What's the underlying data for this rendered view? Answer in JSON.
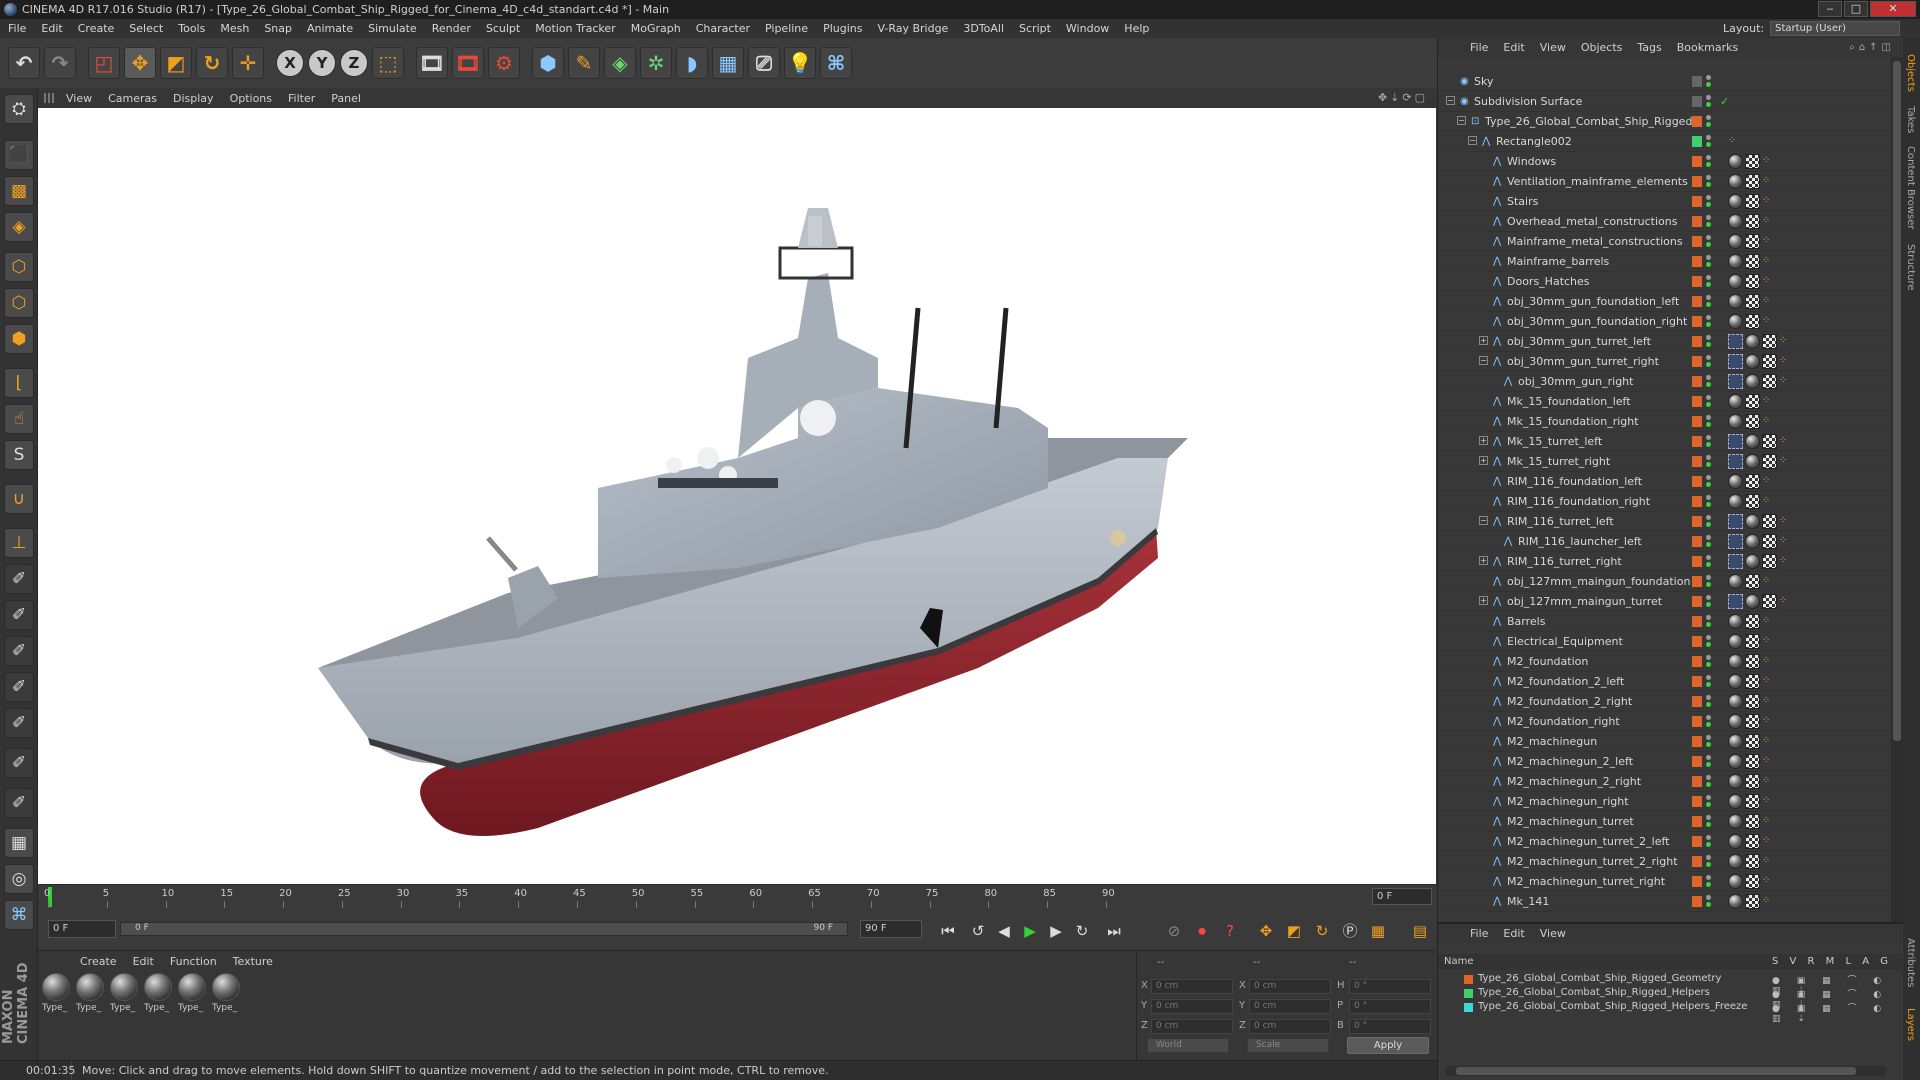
{
  "window": {
    "title": "CINEMA 4D R17.016 Studio (R17) - [Type_26_Global_Combat_Ship_Rigged_for_Cinema_4D_c4d_standart.c4d *] - Main",
    "minimize": "‒",
    "maximize": "□",
    "close": "✕"
  },
  "menu": [
    "File",
    "Edit",
    "Create",
    "Select",
    "Tools",
    "Mesh",
    "Snap",
    "Animate",
    "Simulate",
    "Render",
    "Sculpt",
    "Motion Tracker",
    "MoGraph",
    "Character",
    "Pipeline",
    "Plugins",
    "V-Ray Bridge",
    "3DToAll",
    "Script",
    "Window",
    "Help"
  ],
  "layout": {
    "label": "Layout:",
    "value": "Startup (User)"
  },
  "toolbar": {
    "icons": [
      "undo-icon",
      "redo-icon",
      "live-selection-icon",
      "move-icon",
      "scale-icon",
      "rotate-icon",
      "last-tool-icon",
      "x-axis-icon",
      "y-axis-icon",
      "z-axis-icon",
      "coordinate-system-icon",
      "render-view-icon",
      "render-picture-viewer-icon",
      "render-settings-icon",
      "cube-icon",
      "pen-icon",
      "subdivision-icon",
      "array-icon",
      "deformer-icon",
      "floor-icon",
      "camera-icon",
      "light-icon",
      "python-icon"
    ],
    "axis_labels": [
      "X",
      "Y",
      "Z"
    ]
  },
  "viewport": {
    "menu": [
      "View",
      "Cameras",
      "Display",
      "Options",
      "Filter",
      "Panel"
    ]
  },
  "timeline": {
    "ticks": [
      "0",
      "5",
      "10",
      "15",
      "20",
      "25",
      "30",
      "35",
      "40",
      "45",
      "50",
      "55",
      "60",
      "65",
      "70",
      "75",
      "80",
      "85",
      "90"
    ],
    "current_frame": "0 F"
  },
  "transport": {
    "start_field": "0 F",
    "slider_start": "0 F",
    "slider_end": "90 F",
    "end_field": "90 F"
  },
  "materials": {
    "menu": [
      "Create",
      "Edit",
      "Function",
      "Texture"
    ],
    "items": [
      "Type_",
      "Type_",
      "Type_",
      "Type_",
      "Type_",
      "Type_"
    ]
  },
  "coordinates": {
    "header1": "--",
    "header2": "--",
    "header3": "--",
    "rows": [
      {
        "a": "X",
        "av": "0 cm",
        "b": "X",
        "bv": "0 cm",
        "c": "H",
        "cv": "0 °"
      },
      {
        "a": "Y",
        "av": "0 cm",
        "b": "Y",
        "bv": "0 cm",
        "c": "P",
        "cv": "0 °"
      },
      {
        "a": "Z",
        "av": "0 cm",
        "b": "Z",
        "bv": "0 cm",
        "c": "B",
        "cv": "0 °"
      }
    ],
    "mode1": "World",
    "mode2": "Scale",
    "apply": "Apply"
  },
  "status": {
    "time": "00:01:35",
    "message": "Move: Click and drag to move elements. Hold down SHIFT to quantize movement / add to the selection in point mode, CTRL to remove."
  },
  "object_manager": {
    "menu": [
      "File",
      "Edit",
      "View",
      "Objects",
      "Tags",
      "Bookmarks"
    ],
    "rows": [
      {
        "name": "Sky",
        "depth": 0,
        "exp": "",
        "tags": 0
      },
      {
        "name": "Subdivision Surface",
        "depth": 0,
        "exp": "−",
        "tags": 0
      },
      {
        "name": "Type_26_Global_Combat_Ship_Rigged",
        "depth": 1,
        "exp": "−",
        "tags": 0
      },
      {
        "name": "Rectangle002",
        "depth": 2,
        "exp": "−",
        "tags": 1
      },
      {
        "name": "Windows",
        "depth": 3,
        "exp": "",
        "tags": 3
      },
      {
        "name": "Ventilation_mainframe_elements",
        "depth": 3,
        "exp": "",
        "tags": 3
      },
      {
        "name": "Stairs",
        "depth": 3,
        "exp": "",
        "tags": 3
      },
      {
        "name": "Overhead_metal_constructions",
        "depth": 3,
        "exp": "",
        "tags": 3
      },
      {
        "name": "Mainframe_metal_constructions",
        "depth": 3,
        "exp": "",
        "tags": 3
      },
      {
        "name": "Mainframe_barrels",
        "depth": 3,
        "exp": "",
        "tags": 3
      },
      {
        "name": "Doors_Hatches",
        "depth": 3,
        "exp": "",
        "tags": 3
      },
      {
        "name": "obj_30mm_gun_foundation_left",
        "depth": 3,
        "exp": "",
        "tags": 3
      },
      {
        "name": "obj_30mm_gun_foundation_right",
        "depth": 3,
        "exp": "",
        "tags": 3
      },
      {
        "name": "obj_30mm_gun_turret_left",
        "depth": 3,
        "exp": "+",
        "tags": 4
      },
      {
        "name": "obj_30mm_gun_turret_right",
        "depth": 3,
        "exp": "−",
        "tags": 4
      },
      {
        "name": "obj_30mm_gun_right",
        "depth": 4,
        "exp": "",
        "tags": 4
      },
      {
        "name": "Mk_15_foundation_left",
        "depth": 3,
        "exp": "",
        "tags": 3
      },
      {
        "name": "Mk_15_foundation_right",
        "depth": 3,
        "exp": "",
        "tags": 3
      },
      {
        "name": "Mk_15_turret_left",
        "depth": 3,
        "exp": "+",
        "tags": 4
      },
      {
        "name": "Mk_15_turret_right",
        "depth": 3,
        "exp": "+",
        "tags": 4
      },
      {
        "name": "RIM_116_foundation_left",
        "depth": 3,
        "exp": "",
        "tags": 3
      },
      {
        "name": "RIM_116_foundation_right",
        "depth": 3,
        "exp": "",
        "tags": 3
      },
      {
        "name": "RIM_116_turret_left",
        "depth": 3,
        "exp": "−",
        "tags": 4
      },
      {
        "name": "RIM_116_launcher_left",
        "depth": 4,
        "exp": "",
        "tags": 4
      },
      {
        "name": "RIM_116_turret_right",
        "depth": 3,
        "exp": "+",
        "tags": 4
      },
      {
        "name": "obj_127mm_maingun_foundation",
        "depth": 3,
        "exp": "",
        "tags": 3
      },
      {
        "name": "obj_127mm_maingun_turret",
        "depth": 3,
        "exp": "+",
        "tags": 4
      },
      {
        "name": "Barrels",
        "depth": 3,
        "exp": "",
        "tags": 3
      },
      {
        "name": "Electrical_Equipment",
        "depth": 3,
        "exp": "",
        "tags": 3
      },
      {
        "name": "M2_foundation",
        "depth": 3,
        "exp": "",
        "tags": 3
      },
      {
        "name": "M2_foundation_2_left",
        "depth": 3,
        "exp": "",
        "tags": 3
      },
      {
        "name": "M2_foundation_2_right",
        "depth": 3,
        "exp": "",
        "tags": 3
      },
      {
        "name": "M2_foundation_right",
        "depth": 3,
        "exp": "",
        "tags": 3
      },
      {
        "name": "M2_machinegun",
        "depth": 3,
        "exp": "",
        "tags": 3
      },
      {
        "name": "M2_machinegun_2_left",
        "depth": 3,
        "exp": "",
        "tags": 3
      },
      {
        "name": "M2_machinegun_2_right",
        "depth": 3,
        "exp": "",
        "tags": 3
      },
      {
        "name": "M2_machinegun_right",
        "depth": 3,
        "exp": "",
        "tags": 3
      },
      {
        "name": "M2_machinegun_turret",
        "depth": 3,
        "exp": "",
        "tags": 3
      },
      {
        "name": "M2_machinegun_turret_2_left",
        "depth": 3,
        "exp": "",
        "tags": 3
      },
      {
        "name": "M2_machinegun_turret_2_right",
        "depth": 3,
        "exp": "",
        "tags": 3
      },
      {
        "name": "M2_machinegun_turret_right",
        "depth": 3,
        "exp": "",
        "tags": 3
      },
      {
        "name": "Mk_141",
        "depth": 3,
        "exp": "",
        "tags": 3
      }
    ]
  },
  "side_tabs": [
    "Objects",
    "Takes",
    "Content Browser",
    "Structure"
  ],
  "layer_tabs": [
    "Attributes",
    "Layers"
  ],
  "layer_manager": {
    "menu": [
      "File",
      "Edit",
      "View"
    ],
    "header_name": "Name",
    "header_flags": "S V R M L A G",
    "flags_row": "● ▣ ▦ ⌒ ◐ ▥ ⇣",
    "layers": [
      {
        "name": "Type_26_Global_Combat_Ship_Rigged_Geometry",
        "color": "#e0642a"
      },
      {
        "name": "Type_26_Global_Combat_Ship_Rigged_Helpers",
        "color": "#3fcf6f"
      },
      {
        "name": "Type_26_Global_Combat_Ship_Rigged_Helpers_Freeze",
        "color": "#3fd6d6"
      }
    ]
  }
}
